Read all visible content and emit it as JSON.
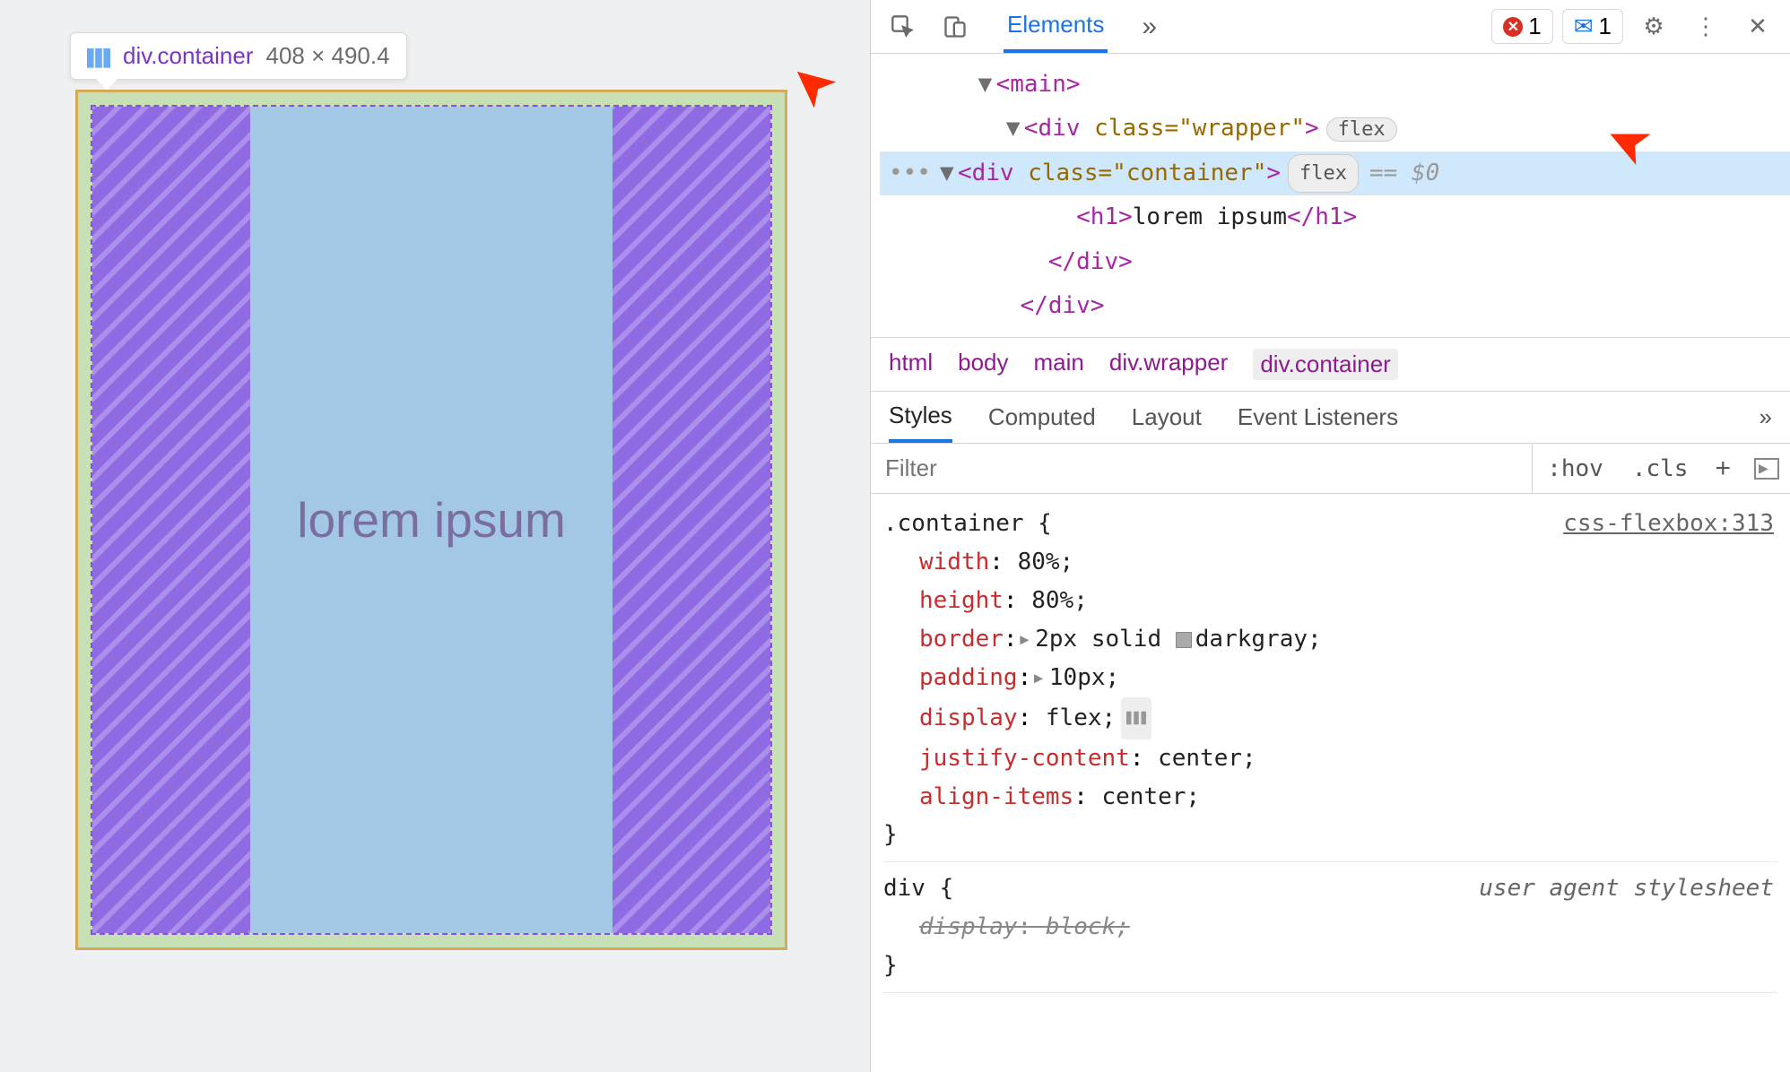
{
  "tooltip": {
    "element": "div.container",
    "dimensions": "408 × 490.4"
  },
  "inspectedText": "lorem ipsum",
  "toolbar": {
    "tabs": [
      "Elements"
    ],
    "errorCount": "1",
    "msgCount": "1"
  },
  "dom": {
    "line1": "<main>",
    "line2_open": "<div ",
    "line2_attr": "class=\"wrapper\"",
    "line2_close": ">",
    "line2_pill": "flex",
    "line3_open": "<div ",
    "line3_attr": "class=\"container\"",
    "line3_close": ">",
    "line3_pill": "flex",
    "line3_suffix": "== $0",
    "line4": "<h1>lorem ipsum</h1>",
    "line5": "</div>",
    "line6": "</div>"
  },
  "breadcrumb": [
    "html",
    "body",
    "main",
    "div.wrapper",
    "div.container"
  ],
  "subTabs": [
    "Styles",
    "Computed",
    "Layout",
    "Event Listeners"
  ],
  "filter": {
    "placeholder": "Filter",
    "hov": ":hov",
    "cls": ".cls"
  },
  "rules": {
    "container": {
      "selector": ".container {",
      "source": "css-flexbox:313",
      "props": [
        {
          "name": "width",
          "value": "80%;"
        },
        {
          "name": "height",
          "value": "80%;"
        },
        {
          "name": "border",
          "value": "2px solid ",
          "color": "darkgray;",
          "expand": true
        },
        {
          "name": "padding",
          "value": "10px;",
          "expand": true
        },
        {
          "name": "display",
          "value": "flex;",
          "editor": true
        },
        {
          "name": "justify-content",
          "value": "center;"
        },
        {
          "name": "align-items",
          "value": "center;"
        }
      ],
      "close": "}"
    },
    "ua": {
      "selector": "div {",
      "source": "user agent stylesheet",
      "prop_name": "display",
      "prop_value": "block;",
      "close": "}"
    }
  }
}
